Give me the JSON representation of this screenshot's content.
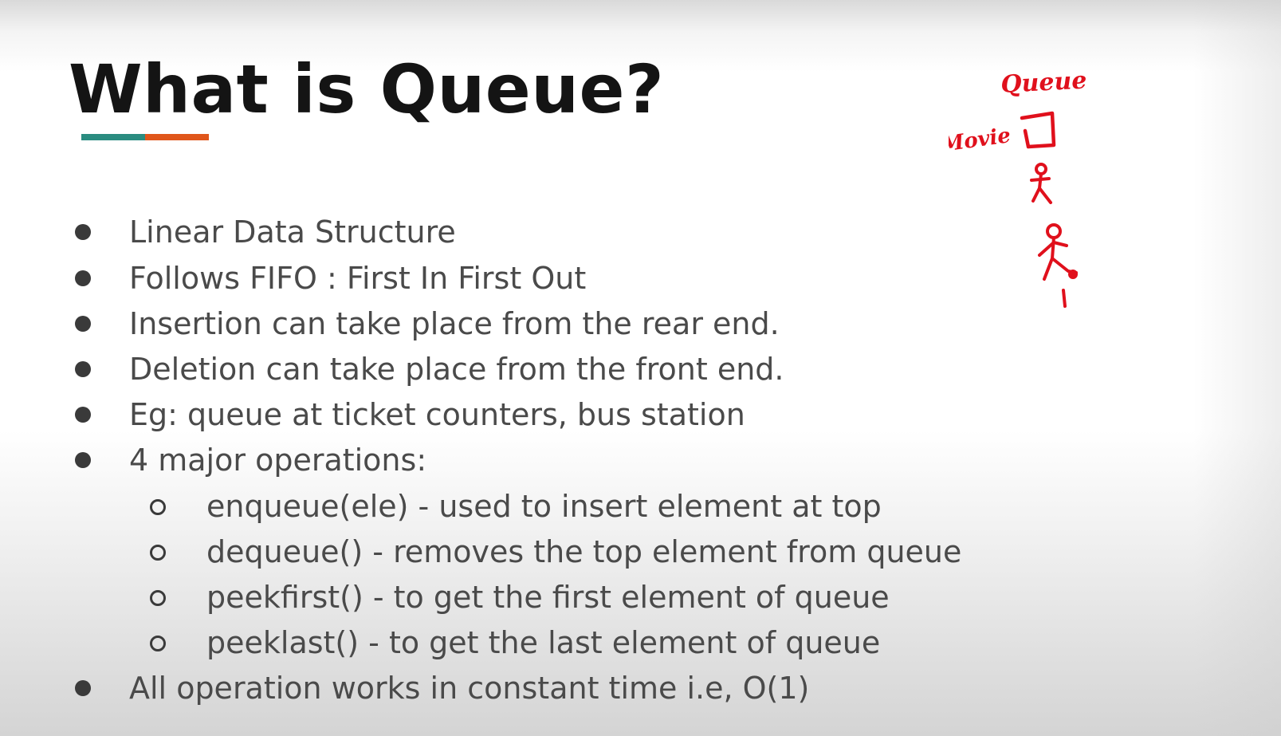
{
  "slide": {
    "title": "What is Queue?",
    "accent_colors": {
      "teal": "#2a8c80",
      "orange": "#e0561b"
    },
    "bullets": [
      "Linear Data Structure",
      "Follows FIFO : First In First Out",
      "Insertion can take place from the rear end.",
      "Deletion can take place from the front end.",
      "Eg: queue at ticket counters, bus station",
      "4 major operations:"
    ],
    "sub_bullets": [
      "enqueue(ele) - used to insert element at top",
      "dequeue() - removes the top element from queue",
      "peekfirst() - to get the first element of queue",
      "peeklast() - to get the last element of queue"
    ],
    "final_bullet": "All operation works in constant time i.e, O(1)"
  },
  "annotation": {
    "color": "#e0101c",
    "queue_label": "Queue",
    "movie_label": "Movie"
  }
}
